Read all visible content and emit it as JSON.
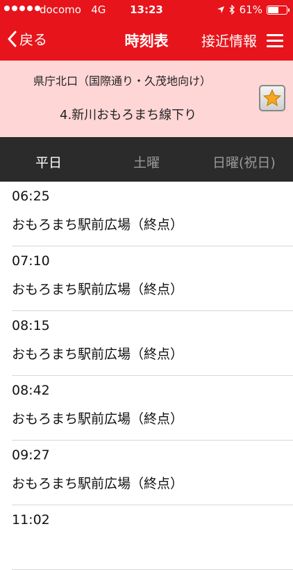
{
  "status_bar": {
    "carrier": "docomo",
    "network": "4G",
    "time": "13:23",
    "battery": "61%",
    "battery_level": 0.61,
    "icons": [
      "signal-dots-icon",
      "location-arrow-icon",
      "bluetooth-icon",
      "battery-icon"
    ]
  },
  "nav": {
    "back_label": "戻る",
    "title": "時刻表",
    "approach_label": "接近情報"
  },
  "stop_info": {
    "stop_name": "県庁北口（国際通り・久茂地向け）",
    "route_name": "4.新川おもろまち線下り",
    "favorite_icon": "star-icon"
  },
  "tabs": [
    {
      "label": "平日",
      "active": true
    },
    {
      "label": "土曜",
      "active": false
    },
    {
      "label": "日曜(祝日)",
      "active": false
    }
  ],
  "departures": [
    {
      "time": "06:25",
      "destination": "おもろまち駅前広場（終点）"
    },
    {
      "time": "07:10",
      "destination": "おもろまち駅前広場（終点）"
    },
    {
      "time": "08:15",
      "destination": "おもろまち駅前広場（終点）"
    },
    {
      "time": "08:42",
      "destination": "おもろまち駅前広場（終点）"
    },
    {
      "time": "09:27",
      "destination": "おもろまち駅前広場（終点）"
    },
    {
      "time": "11:02",
      "destination": ""
    }
  ],
  "colors": {
    "header_red": "#e8141b",
    "info_pink": "#ffd6d6",
    "tab_bar": "#2b2b2b"
  }
}
